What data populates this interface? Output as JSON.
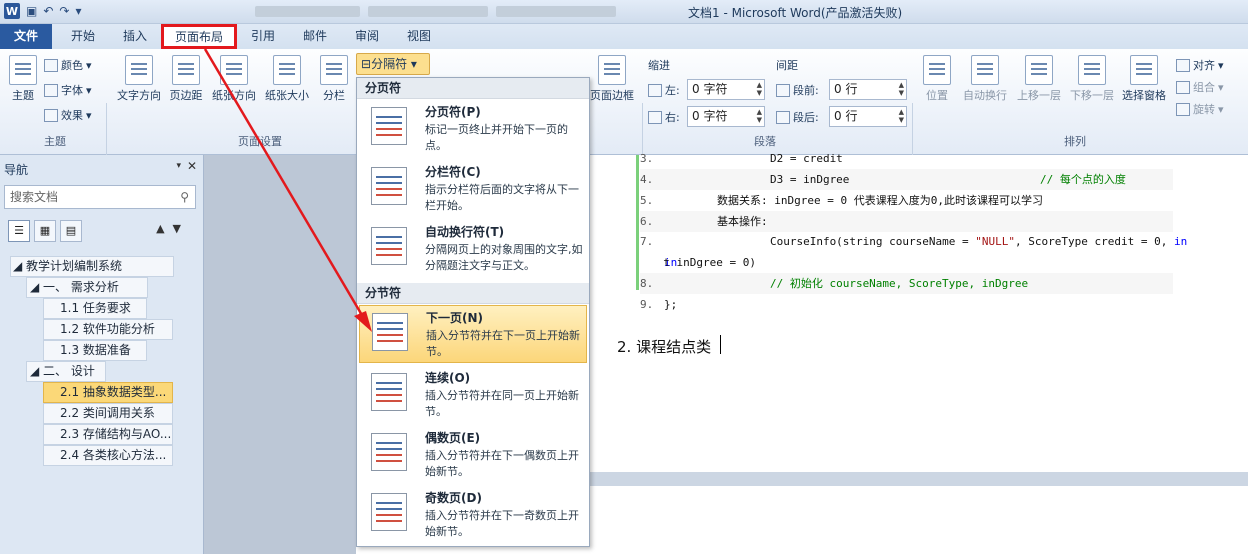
{
  "titlebar": {
    "app_icon": "W",
    "title": "文档1 - Microsoft Word(产品激活失败)"
  },
  "tabs": [
    {
      "label": "文件"
    },
    {
      "label": "开始"
    },
    {
      "label": "插入"
    },
    {
      "label": "页面布局"
    },
    {
      "label": "引用"
    },
    {
      "label": "邮件"
    },
    {
      "label": "审阅"
    },
    {
      "label": "视图"
    }
  ],
  "ribbon": {
    "theme": {
      "main": "主题",
      "colors": "颜色",
      "fonts": "字体",
      "effects": "效果",
      "group": "主题"
    },
    "page_setup": {
      "text_dir": "文字方向",
      "margins": "页边距",
      "orientation": "纸张方向",
      "size": "纸张大小",
      "columns": "分栏",
      "breaks": "分隔符",
      "group": "页面设置"
    },
    "background": {
      "page_border": "页面边框"
    },
    "paragraph": {
      "indent": "缩进",
      "spacing": "间距",
      "left": "左:",
      "right": "右:",
      "before": "段前:",
      "after": "段后:",
      "left_val": "0 字符",
      "right_val": "0 字符",
      "before_val": "0 行",
      "after_val": "0 行",
      "group": "段落"
    },
    "arrange": {
      "position": "位置",
      "wrap": "自动换行",
      "forward": "上移一层",
      "backward": "下移一层",
      "selection": "选择窗格",
      "align": "对齐",
      "group_obj": "组合",
      "rotate": "旋转",
      "group": "排列"
    }
  },
  "nav": {
    "title": "导航",
    "search_placeholder": "搜索文档",
    "headings": [
      {
        "label": "教学计划编制系统"
      },
      {
        "label": "一、 需求分析"
      },
      {
        "label": "1.1 任务要求"
      },
      {
        "label": "1.2 软件功能分析"
      },
      {
        "label": "1.3 数据准备"
      },
      {
        "label": "二、 设计"
      },
      {
        "label": "2.1 抽象数据类型..."
      },
      {
        "label": "2.2 类间调用关系"
      },
      {
        "label": "2.3 存储结构与AO..."
      },
      {
        "label": "2.4 各类核心方法..."
      }
    ]
  },
  "document": {
    "code": [
      {
        "n": "3.",
        "text": "                D2 = credit"
      },
      {
        "n": "4.",
        "text": "                D3 = inDgree",
        "comment": "// 每个点的入度"
      },
      {
        "n": "5.",
        "text": "        数据关系: inDgree = 0 代表课程入度为0,此时该课程可以学习"
      },
      {
        "n": "6.",
        "text": "        基本操作:"
      },
      {
        "n": "7.",
        "pre": "                CourseInfo(string courseName = ",
        "str": "\"NULL\"",
        "post": ", ScoreType credit = 0, ",
        "kw": "in"
      },
      {
        "n": "",
        "text": "t inDgree = 0)"
      },
      {
        "n": "8.",
        "comment": "                // 初始化 courseName, ScoreType, inDgree"
      },
      {
        "n": "9.",
        "text": "};"
      }
    ],
    "heading": "2. 课程结点类"
  },
  "menu": {
    "button": "分隔符",
    "section1": "分页符",
    "section2": "分节符",
    "items": [
      {
        "title": "分页符(P)",
        "desc": "标记一页终止并开始下一页的点。"
      },
      {
        "title": "分栏符(C)",
        "desc": "指示分栏符后面的文字将从下一栏开始。"
      },
      {
        "title": "自动换行符(T)",
        "desc": "分隔网页上的对象周围的文字,如分隔题注文字与正文。"
      },
      {
        "title": "下一页(N)",
        "desc": "插入分节符并在下一页上开始新节。"
      },
      {
        "title": "连续(O)",
        "desc": "插入分节符并在同一页上开始新节。"
      },
      {
        "title": "偶数页(E)",
        "desc": "插入分节符并在下一偶数页上开始新节。"
      },
      {
        "title": "奇数页(D)",
        "desc": "插入分节符并在下一奇数页上开始新节。"
      }
    ]
  },
  "colors": {
    "annotation": "#e3191d",
    "file_tab": "#2a5aa0",
    "hover": "#fcd67a"
  }
}
